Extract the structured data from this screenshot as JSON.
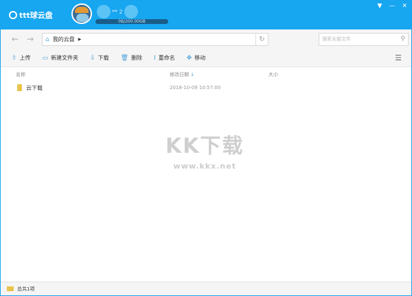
{
  "header": {
    "app_name": "ttt球云盘",
    "username_suffix": "** 2",
    "quota": "0B/200.00GB"
  },
  "nav": {
    "path": "我的云盘",
    "search_placeholder": "搜索全部文件"
  },
  "toolbar": {
    "upload": "上传",
    "new_folder": "新建文件夹",
    "download": "下载",
    "delete": "删除",
    "rename": "重命名",
    "move": "移动"
  },
  "columns": {
    "name": "名称",
    "date": "修改日期",
    "size": "大小"
  },
  "files": [
    {
      "name": "云下载",
      "date": "2018-10-09 10:57:00",
      "size": ""
    }
  ],
  "status": {
    "count": "总共1项"
  },
  "watermark": {
    "title": "KK下载",
    "url": "www.kkx.net"
  }
}
